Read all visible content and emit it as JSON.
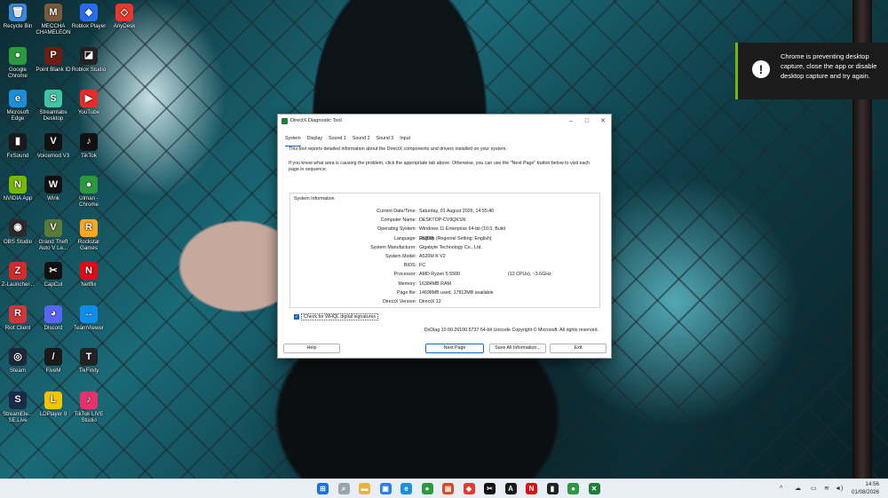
{
  "desktop": {
    "icons": [
      {
        "label": "Recycle Bin",
        "icon": "recycle-bin-icon",
        "color": "#3a8ad8",
        "glyph": "🗑"
      },
      {
        "label": "MECCHA CHAMELEON",
        "icon": "meccha-chameleon-icon",
        "color": "#7a5a3a",
        "glyph": "M"
      },
      {
        "label": "Roblox Player",
        "icon": "roblox-player-icon",
        "color": "#2a6cf0",
        "glyph": "◆"
      },
      {
        "label": "AnyDesk",
        "icon": "anydesk-icon",
        "color": "#e5392b",
        "glyph": "◇"
      },
      {
        "label": "Google Chrome",
        "icon": "chrome-icon",
        "color": "#2b9a3f",
        "glyph": "●"
      },
      {
        "label": "Point Blank ID",
        "icon": "point-blank-icon",
        "color": "#6b1e12",
        "glyph": "P"
      },
      {
        "label": "Roblox Studio",
        "icon": "roblox-studio-icon",
        "color": "#222222",
        "glyph": "◪"
      },
      {
        "label": "Microsoft Edge",
        "icon": "edge-icon",
        "color": "#1d8ed8",
        "glyph": "e"
      },
      {
        "label": "Streamlabs Desktop",
        "icon": "streamlabs-icon",
        "color": "#41c3a4",
        "glyph": "S"
      },
      {
        "label": "YouTube",
        "icon": "youtube-icon",
        "color": "#e52d27",
        "glyph": "▶"
      },
      {
        "label": "FxSound",
        "icon": "fxsound-icon",
        "color": "#1a1a1a",
        "glyph": "▮"
      },
      {
        "label": "Voicemod V3",
        "icon": "voicemod-icon",
        "color": "#111111",
        "glyph": "V"
      },
      {
        "label": "TikTok",
        "icon": "tiktok-icon",
        "color": "#111111",
        "glyph": "♪"
      },
      {
        "label": "NVIDIA App",
        "icon": "nvidia-icon",
        "color": "#76b900",
        "glyph": "N"
      },
      {
        "label": "Wink",
        "icon": "wink-icon",
        "color": "#111111",
        "glyph": "W"
      },
      {
        "label": "Ulman - Chrome",
        "icon": "chrome-profile-icon",
        "color": "#2b9a3f",
        "glyph": "●"
      },
      {
        "label": "OBS Studio",
        "icon": "obs-icon",
        "color": "#2a2a2a",
        "glyph": "◉"
      },
      {
        "label": "Grand Theft Auto V Le...",
        "icon": "gta-icon",
        "color": "#5a7a3a",
        "glyph": "V"
      },
      {
        "label": "Rockstar Games",
        "icon": "rockstar-icon",
        "color": "#f5a623",
        "glyph": "R"
      },
      {
        "label": "Z-Launcher...",
        "icon": "z-launcher-icon",
        "color": "#d42a2a",
        "glyph": "Z"
      },
      {
        "label": "CapCut",
        "icon": "capcut-icon",
        "color": "#111111",
        "glyph": "✂"
      },
      {
        "label": "Netflix",
        "icon": "netflix-icon",
        "color": "#e50914",
        "glyph": "N"
      },
      {
        "label": "Riot Client",
        "icon": "riot-client-icon",
        "color": "#d13639",
        "glyph": "R"
      },
      {
        "label": "Discord",
        "icon": "discord-icon",
        "color": "#5865f2",
        "glyph": "◕"
      },
      {
        "label": "TeamViewer",
        "icon": "teamviewer-icon",
        "color": "#0e8ee9",
        "glyph": "↔"
      },
      {
        "label": "Steam",
        "icon": "steam-icon",
        "color": "#1b2838",
        "glyph": "◎"
      },
      {
        "label": "FiveM",
        "icon": "fivem-icon",
        "color": "#1a1a1a",
        "glyph": "/"
      },
      {
        "label": "TikFinity",
        "icon": "tikfinity-icon",
        "color": "#222222",
        "glyph": "T"
      },
      {
        "label": "StreamEle... SE.Live",
        "icon": "streamelements-icon",
        "color": "#1a2a4a",
        "glyph": "S"
      },
      {
        "label": "LDPlayer 9",
        "icon": "ldplayer-icon",
        "color": "#f5c400",
        "glyph": "L"
      },
      {
        "label": "TikTok LIVE Studio",
        "icon": "tiktok-live-icon",
        "color": "#e5326a",
        "glyph": "♪"
      }
    ]
  },
  "notification": {
    "message": "Chrome is preventing desktop capture, close the app or disable desktop capture and try again."
  },
  "dxdiag": {
    "title": "DirectX Diagnostic Tool",
    "tabs": [
      "System",
      "Display",
      "Sound 1",
      "Sound 2",
      "Sound 3",
      "Input"
    ],
    "intro1": "This tool reports detailed information about the DirectX components and drivers installed on your system.",
    "intro2": "If you know what area is causing the problem, click the appropriate tab above. Otherwise, you can use the \"Next Page\" button below to visit each page in sequence.",
    "group_title": "System Information",
    "rows": [
      {
        "k": "Current Date/Time:",
        "v": "Saturday, 01 August 2026, 14:55:40",
        "v2": ""
      },
      {
        "k": "Computer Name:",
        "v": "DESKTOP-CV9QKSN",
        "v2": ""
      },
      {
        "k": "Operating System:",
        "v": "Windows 11 Enterprise 64-bit (10.0, Build 26200)",
        "v2": ""
      },
      {
        "k": "Language:",
        "v": "English (Regional Setting: English)",
        "v2": ""
      },
      {
        "k": "System Manufacturer:",
        "v": "Gigabyte Technology Co., Ltd.",
        "v2": ""
      },
      {
        "k": "System Model:",
        "v": "A520M K V2",
        "v2": ""
      },
      {
        "k": "BIOS:",
        "v": "FC",
        "v2": ""
      },
      {
        "k": "Processor:",
        "v": "AMD Ryzen 5 5500",
        "v2": "(12 CPUs), ~3.6GHz"
      },
      {
        "k": "Memory:",
        "v": "16384MB RAM",
        "v2": ""
      },
      {
        "k": "Page file:",
        "v": "14698MB used, 17812MB available",
        "v2": ""
      },
      {
        "k": "DirectX Version:",
        "v": "DirectX 12",
        "v2": ""
      }
    ],
    "whql_label": "Check for WHQL digital signatures",
    "footer": "DxDiag 10.00.26100.5737 64-bit Unicode  Copyright © Microsoft. All rights reserved.",
    "buttons": {
      "help": "Help",
      "next": "Next Page",
      "save": "Save All Information...",
      "exit": "Exit"
    }
  },
  "taskbar": {
    "apps": [
      {
        "icon": "start-icon",
        "color": "#1e6fd9",
        "glyph": "⊞"
      },
      {
        "icon": "search-icon",
        "color": "#9aa4ae",
        "glyph": "⌕"
      },
      {
        "icon": "file-explorer-icon",
        "color": "#e8b33a",
        "glyph": "▬"
      },
      {
        "icon": "store-icon",
        "color": "#2a7de1",
        "glyph": "▣"
      },
      {
        "icon": "edge-icon",
        "color": "#1d8ed8",
        "glyph": "e"
      },
      {
        "icon": "chrome-icon",
        "color": "#2b9a3f",
        "glyph": "●"
      },
      {
        "icon": "notepad-icon",
        "color": "#d44a2a",
        "glyph": "▤"
      },
      {
        "icon": "roblox-icon",
        "color": "#e5392b",
        "glyph": "◆"
      },
      {
        "icon": "capcut-icon",
        "color": "#111111",
        "glyph": "✂"
      },
      {
        "icon": "fivem-icon",
        "color": "#1a1a1a",
        "glyph": "A"
      },
      {
        "icon": "netflix-icon",
        "color": "#e50914",
        "glyph": "N"
      },
      {
        "icon": "fxsound-icon",
        "color": "#222222",
        "glyph": "▮"
      },
      {
        "icon": "chrome-profile-icon",
        "color": "#2b9a3f",
        "glyph": "●"
      },
      {
        "icon": "dxdiag-icon",
        "color": "#1e7d3a",
        "glyph": "✕"
      }
    ],
    "clock_time": "14:56",
    "clock_date": "01/08/2026"
  }
}
